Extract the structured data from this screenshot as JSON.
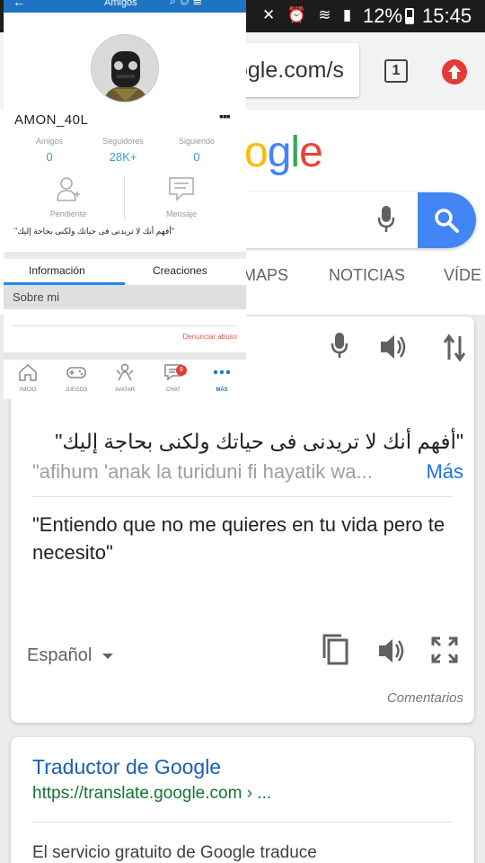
{
  "status_bar": {
    "battery": "12%",
    "time": "15:45"
  },
  "browser": {
    "url_text": "ogle.com/s",
    "tab_count": "1"
  },
  "google": {
    "logo_text": "ogle",
    "tabs": [
      "MAPS",
      "NOTICIAS",
      "VÍDE"
    ]
  },
  "translate_card": {
    "source_text": "\"أفهم أنك لا تريدنى فى حياتك ولكنى بحاجة إليك\"",
    "transliteration": "\"afihum 'anak la turiduni fi hayatik wa...",
    "more_label": "Más",
    "translation": "\"Entiendo que no me quieres en tu vida pero te necesito\"",
    "target_language": "Español",
    "feedback_label": "Comentarios"
  },
  "result": {
    "title": "Traductor de Google",
    "url": "https://translate.google.com › ...",
    "snippet": "El servicio gratuito de Google traduce"
  },
  "app_overlay": {
    "header_title": "Amigos",
    "username": "AMON_40L",
    "stats": [
      {
        "label": "Amigos",
        "value": "0"
      },
      {
        "label": "Seguidores",
        "value": "28K+"
      },
      {
        "label": "Siguiendo",
        "value": "0"
      }
    ],
    "actions": [
      {
        "label": "Pendiente"
      },
      {
        "label": "Mensaje"
      }
    ],
    "quote": "\"أفهم أنك لا تريدنى فى حياتك ولكنى بحاجة إليك\"",
    "tabs": [
      {
        "label": "Información",
        "active": true
      },
      {
        "label": "Creaciones",
        "active": false
      }
    ],
    "about_label": "Sobre mi",
    "report_label": "Denunciar abuso",
    "nav": [
      {
        "label": "INICIO",
        "icon": "home-icon"
      },
      {
        "label": "JUEGOS",
        "icon": "gamepad-icon"
      },
      {
        "label": "AVATAR",
        "icon": "avatar-icon"
      },
      {
        "label": "CHAT",
        "icon": "chat-icon",
        "badge": "8"
      },
      {
        "label": "MÁS",
        "icon": "more-icon",
        "active": true
      }
    ],
    "accent_color": "#1e74c2"
  }
}
